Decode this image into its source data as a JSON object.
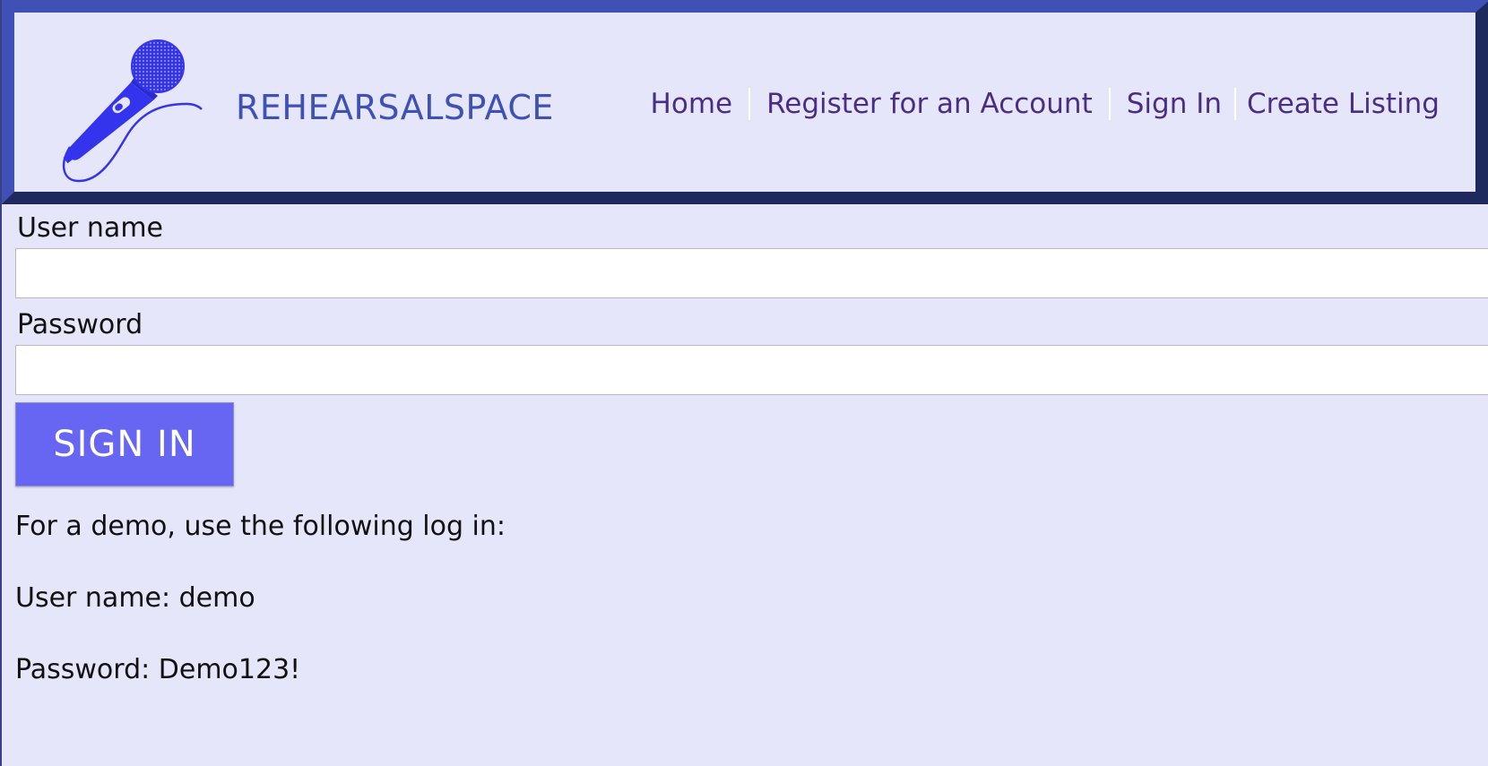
{
  "header": {
    "brand": "REHEARSALSPACE",
    "logo_icon": "microphone-icon",
    "nav": {
      "home": "Home",
      "register": "Register for an Account",
      "sign_in": "Sign In",
      "create_listing": "Create Listing"
    }
  },
  "form": {
    "username_label": "User name",
    "username_value": "",
    "password_label": "Password",
    "password_value": "",
    "submit_label": "SIGN IN"
  },
  "demo": {
    "intro": "For a demo, use the following log in:",
    "username_line": "User name: demo",
    "password_line": "Password: Demo123!"
  },
  "colors": {
    "background": "#e6e6fa",
    "brand": "#3f51b5",
    "nav_link": "#4b2e83",
    "button": "#6666f2",
    "header_frame_light": "#3f51b5",
    "header_frame_dark": "#1e2a5e"
  }
}
